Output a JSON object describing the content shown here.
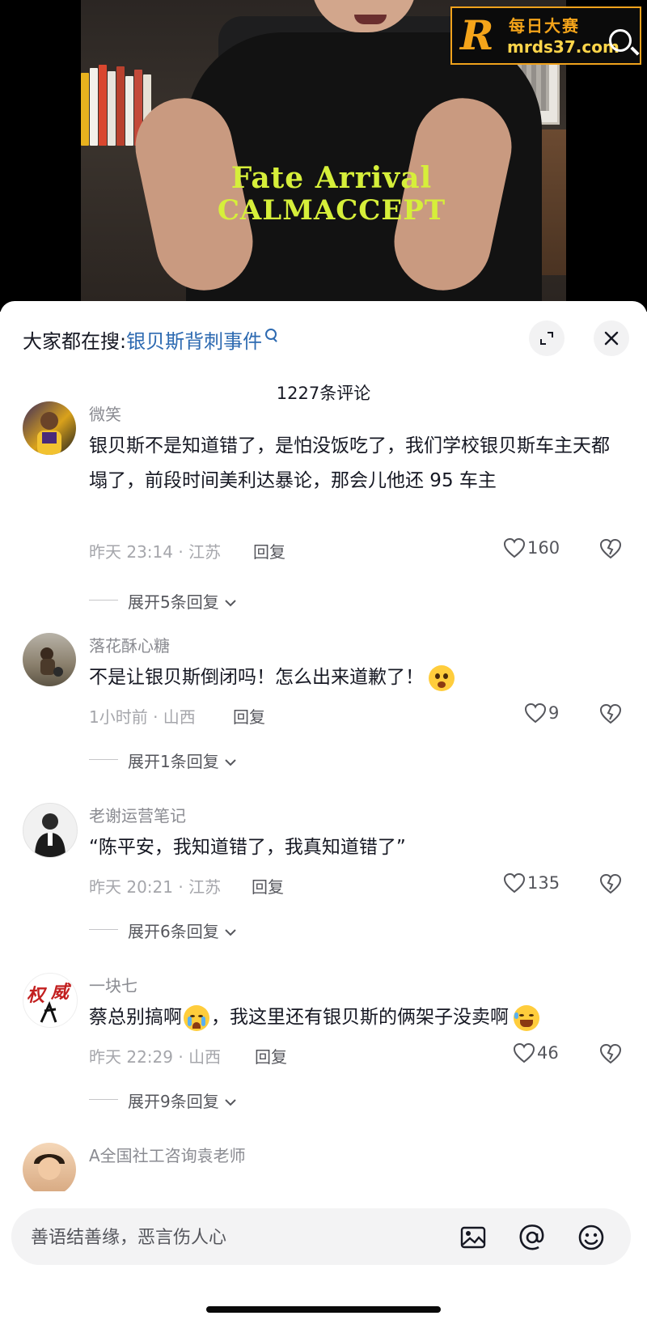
{
  "watermark": {
    "logo_letter": "R",
    "name": "每日大赛",
    "url": "mrds37.com"
  },
  "video": {
    "shirt_line1": "Fate Arrival",
    "shirt_line2": "CALMACCEPT"
  },
  "search": {
    "prefix": "大家都在搜:",
    "term": "银贝斯背刺事件"
  },
  "comment_count": "1227条评论",
  "comments": [
    {
      "username": "微笑",
      "text": "银贝斯不是知道错了，是怕没饭吃了，我们学校银贝斯车主天都塌了，前段时间美利达暴论，那会儿他还 95 车主",
      "meta": "昨天 23:14 · 江苏",
      "reply": "回复",
      "likes": "160",
      "expand": "展开5条回复"
    },
    {
      "username": "落花酥心糖",
      "text": "不是让银贝斯倒闭吗！怎么出来道歉了！",
      "meta": "1小时前 · 山西",
      "reply": "回复",
      "likes": "9",
      "expand": "展开1条回复"
    },
    {
      "username": "老谢运营笔记",
      "text": "“陈平安，我知道错了，我真知道错了”",
      "meta": "昨天 20:21 · 江苏",
      "reply": "回复",
      "likes": "135",
      "expand": "展开6条回复"
    },
    {
      "username": "一块七",
      "text": "蔡总别搞啊",
      "text2": "，我这里还有银贝斯的俩架子没卖啊",
      "meta": "昨天 22:29 · 山西",
      "reply": "回复",
      "likes": "46",
      "expand": "展开9条回复"
    },
    {
      "username": "A全国社工咨询袁老师"
    }
  ],
  "input": {
    "placeholder": "善语结善缘，恶言伤人心"
  },
  "icons": [
    "search-icon",
    "expand-icon",
    "close-icon",
    "heart-icon",
    "dislike-icon",
    "chevron-down-icon",
    "image-icon",
    "at-icon",
    "emoji-icon"
  ]
}
